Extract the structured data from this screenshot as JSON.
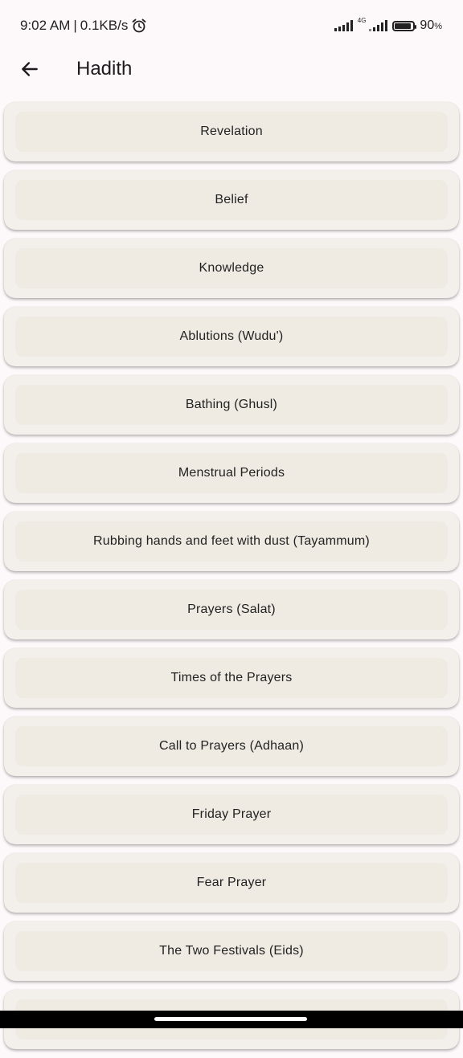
{
  "status_bar": {
    "time": "9:02 AM",
    "separator": "|",
    "speed": "0.1KB/s",
    "network_small": "4G",
    "battery_percent": "90",
    "battery_unit": "%",
    "battery_level": 0.9,
    "icons": [
      "alarm-icon",
      "signal-icon",
      "signal-4g-icon",
      "battery-icon"
    ]
  },
  "app_bar": {
    "back_icon": "arrow-back-icon",
    "title": "Hadith"
  },
  "chapters": [
    {
      "label": "Revelation"
    },
    {
      "label": "Belief"
    },
    {
      "label": "Knowledge"
    },
    {
      "label": "Ablutions (Wudu')"
    },
    {
      "label": "Bathing (Ghusl)"
    },
    {
      "label": "Menstrual Periods"
    },
    {
      "label": "Rubbing hands and feet with dust (Tayammum)"
    },
    {
      "label": "Prayers (Salat)"
    },
    {
      "label": "Times of the Prayers"
    },
    {
      "label": "Call to Prayers (Adhaan)"
    },
    {
      "label": "Friday Prayer"
    },
    {
      "label": "Fear Prayer"
    },
    {
      "label": "The Two Festivals (Eids)"
    },
    {
      "label": ""
    }
  ]
}
